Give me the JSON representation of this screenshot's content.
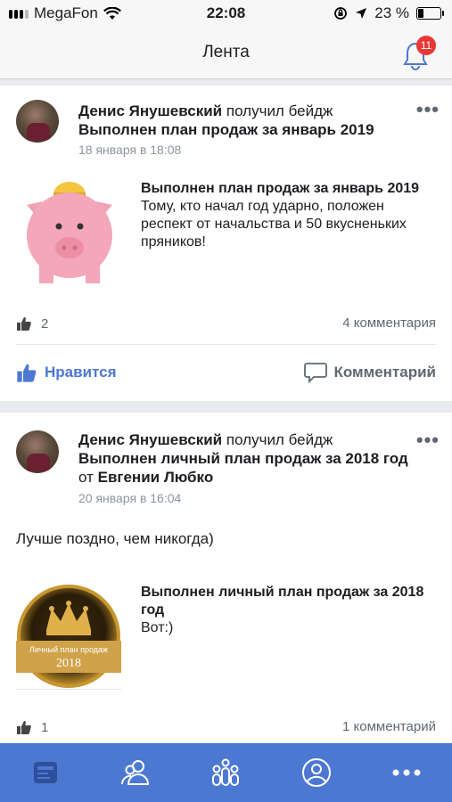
{
  "status_bar": {
    "carrier": "MegaFon",
    "time": "22:08",
    "battery_percent": "23 %",
    "battery_level": 0.23
  },
  "nav": {
    "title": "Лента",
    "notifications_count": "11"
  },
  "posts": [
    {
      "author": "Денис Янушевский",
      "action": "получил бейдж",
      "badge_name": "Выполнен план продаж за январь 2019",
      "date": "18 января в 18:08",
      "badge_title": "Выполнен план продаж за январь 2019",
      "badge_description": "Тому, кто начал год ударно, положен респект от начальства и 50 вкусненьких пряников!",
      "likes": "2",
      "comments": "4 комментария",
      "like_label": "Нравится",
      "comment_label": "Комментарий"
    },
    {
      "author": "Денис Янушевский",
      "action": "получил бейдж",
      "badge_name": "Выполнен личный план продаж за 2018 год",
      "from_word": "от",
      "from_person": "Евгении Любко",
      "date": "20 января в 16:04",
      "text": "Лучше поздно, чем никогда)",
      "badge_title": "Выполнен личный план продаж за 2018 год",
      "badge_description": "Вот:)",
      "badge_image_caption": "Личный план продаж",
      "badge_image_year": "2018",
      "likes": "1",
      "comments": "1 комментарий"
    }
  ],
  "tabbar": {
    "items": [
      "feed-icon",
      "people-icon",
      "team-icon",
      "profile-icon",
      "more-icon"
    ],
    "background": "#4d78d2"
  },
  "colors": {
    "accent": "#4d78d2",
    "badge": "#e53935"
  }
}
